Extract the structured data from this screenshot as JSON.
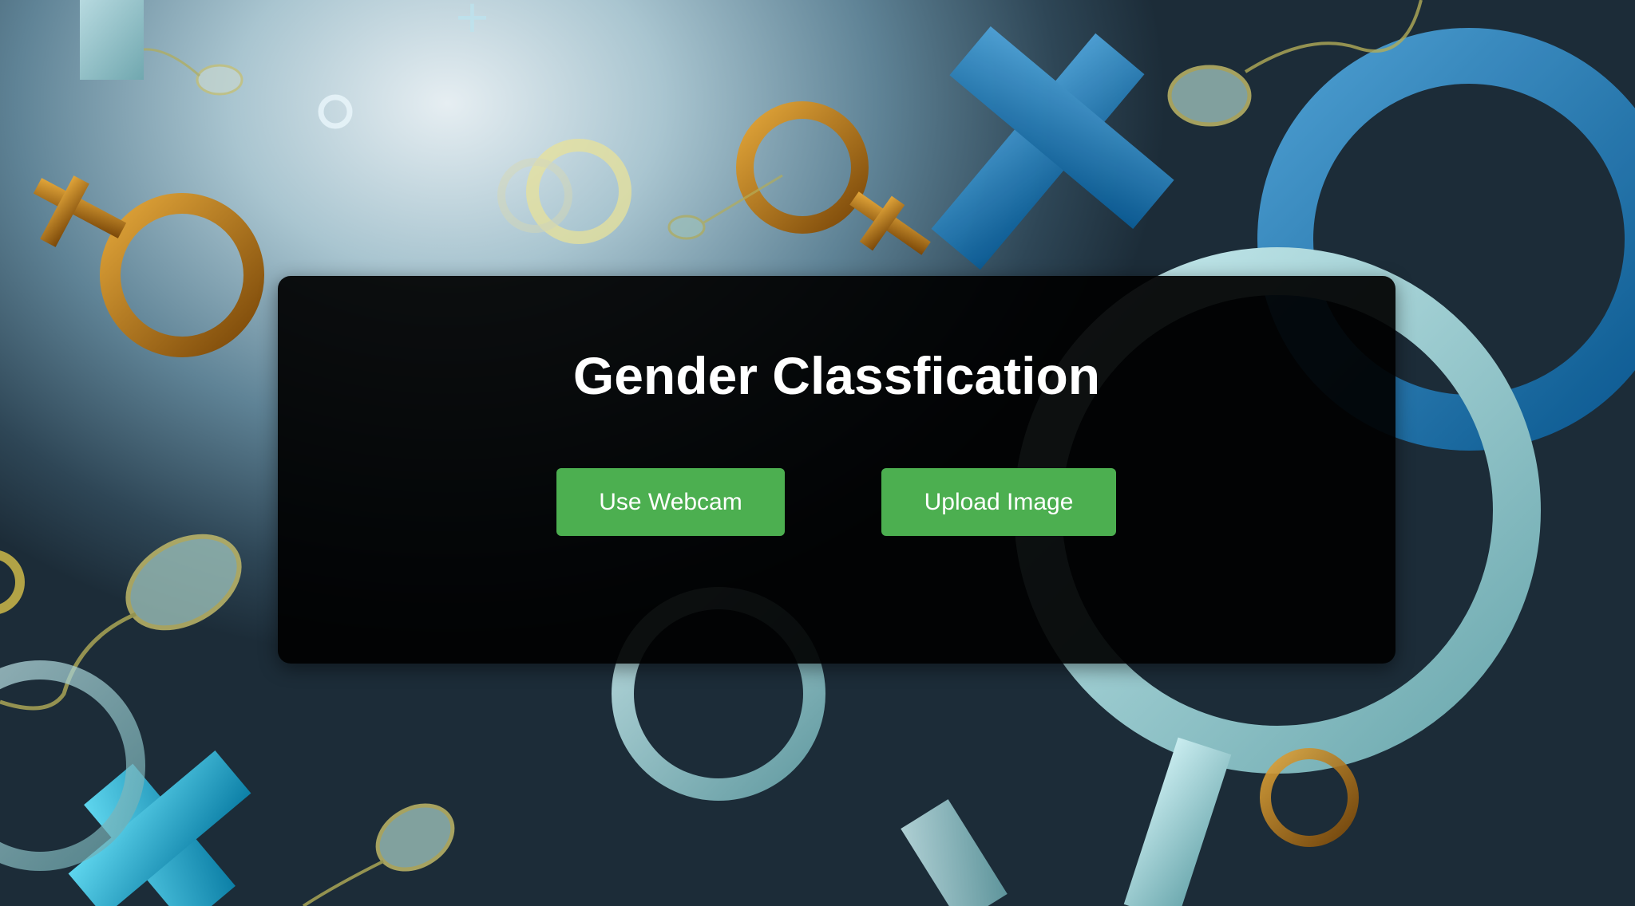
{
  "page": {
    "title": "Gender Classfication"
  },
  "buttons": {
    "webcam_label": "Use Webcam",
    "upload_label": "Upload Image"
  },
  "colors": {
    "panel_background": "#000000",
    "button_accent": "#4caf50",
    "text": "#ffffff"
  },
  "background": {
    "description_icons": [
      "female-symbol-icon",
      "male-symbol-icon",
      "sperm-icon"
    ]
  }
}
